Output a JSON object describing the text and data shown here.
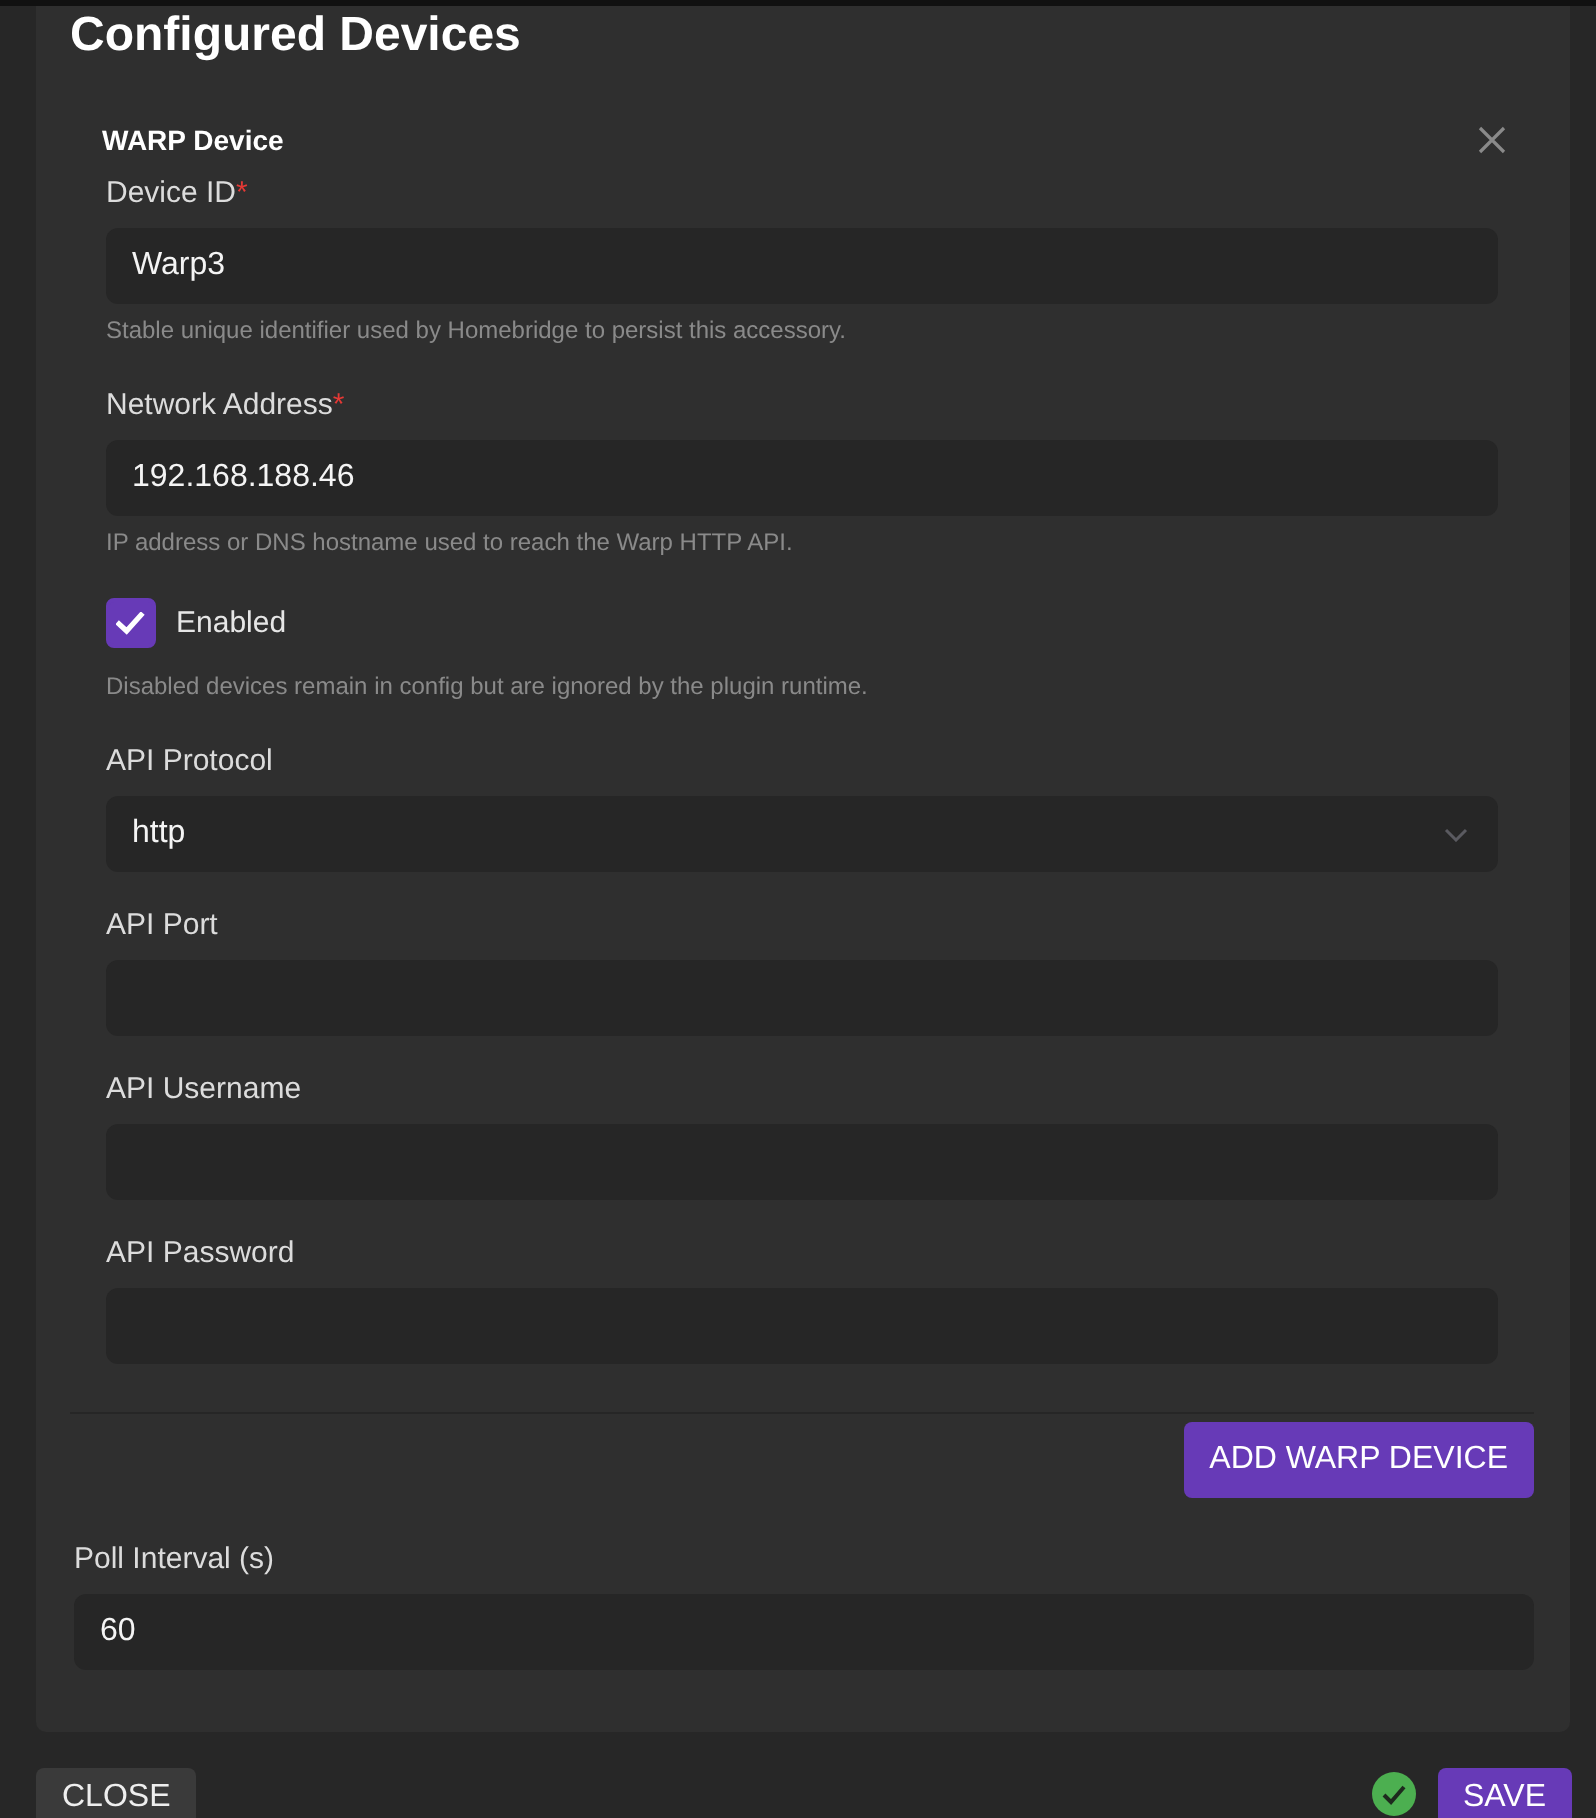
{
  "section": {
    "title": "Configured Devices"
  },
  "device_items": [
    {
      "title": "WARP Device",
      "fields": [
        {
          "kind": "text",
          "label": "Device ID",
          "required_mark": "*",
          "value": "Warp3",
          "help": "Stable unique identifier used by Homebridge to persist this accessory."
        },
        {
          "kind": "text",
          "label": "Network Address",
          "required_mark": "*",
          "value": "192.168.188.46",
          "help": "IP address or DNS hostname used to reach the Warp HTTP API."
        },
        {
          "kind": "checkbox",
          "label": "Enabled",
          "checked": true,
          "help": "Disabled devices remain in config but are ignored by the plugin runtime."
        },
        {
          "kind": "select",
          "label": "API Protocol",
          "value": "http"
        },
        {
          "kind": "text",
          "label": "API Port"
        },
        {
          "kind": "text",
          "label": "API Username"
        },
        {
          "kind": "text",
          "label": "API Password"
        }
      ]
    }
  ],
  "add_button": "ADD WARP DEVICE",
  "poll_interval": {
    "label": "Poll Interval (s)",
    "value": "60"
  },
  "footer": {
    "close_button": "CLOSE",
    "save_button": "SAVE"
  }
}
